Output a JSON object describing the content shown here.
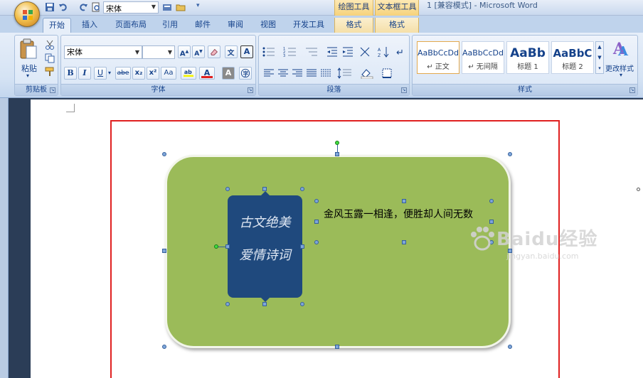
{
  "title_bar": {
    "window_title": "1 [兼容模式] - Microsoft Word",
    "quick_font": "宋体",
    "context_groups": [
      "绘图工具",
      "文本框工具"
    ]
  },
  "tabs": [
    "开始",
    "插入",
    "页面布局",
    "引用",
    "邮件",
    "审阅",
    "视图",
    "开发工具",
    "格式",
    "格式"
  ],
  "ribbon": {
    "clipboard": {
      "paste_label": "粘贴",
      "group_label": "剪贴板"
    },
    "font": {
      "font_name": "宋体",
      "font_size": "",
      "group_label": "字体",
      "buttons": [
        "B",
        "I",
        "U",
        "abe",
        "x₂",
        "x²",
        "Aa",
        "A",
        "A"
      ]
    },
    "paragraph": {
      "group_label": "段落"
    },
    "styles": {
      "group_label": "样式",
      "cards": [
        {
          "sample": "AaBbCcDd",
          "name": "正文"
        },
        {
          "sample": "AaBbCcDd",
          "name": "无间隔"
        },
        {
          "sample": "AaBb",
          "name": "标题 1"
        },
        {
          "sample": "AaBbC",
          "name": "标题 2"
        }
      ],
      "change_styles": "更改样式"
    }
  },
  "document": {
    "poem_lines": [
      "古文绝美",
      "爱情诗词"
    ],
    "textbox_text": "金风玉露一相逢，便胜却人间无数"
  },
  "watermark": {
    "brand": "Baidu经验",
    "url": "jingyan.baidu.com"
  },
  "colors": {
    "shape_fill": "#9bbb59",
    "card_fill": "#1f497d",
    "frame": "#e02020"
  }
}
